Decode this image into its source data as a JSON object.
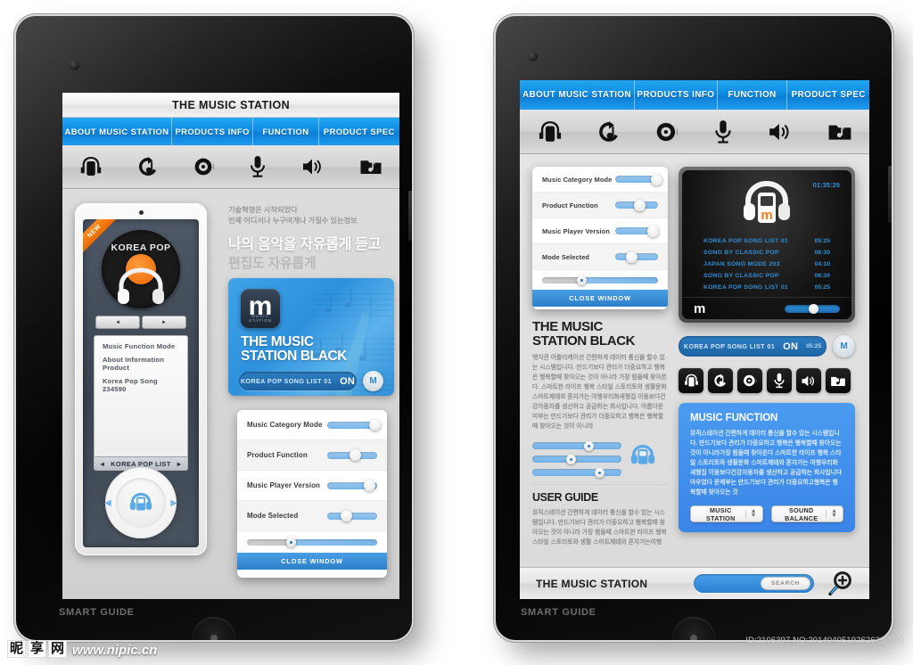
{
  "left_tablet": {
    "title": "THE MUSIC STATION",
    "nav": [
      {
        "label": "ABOUT MUSIC STATION"
      },
      {
        "label": "PRODUCTS INFO"
      },
      {
        "label": "FUNCTION"
      },
      {
        "label": "PRODUCT SPEC"
      }
    ],
    "icons": [
      "headphone-player-icon",
      "refresh-note-icon",
      "disc-icon",
      "microphone-icon",
      "speaker-icon",
      "music-folder-icon"
    ],
    "phone": {
      "badge": "NEW",
      "disc_title": "KOREA POP",
      "prev": "◄",
      "next": "►",
      "list": [
        "Music Function Mode",
        "About Information Product",
        "Korea Pop Song 234590"
      ],
      "list_footer": "KOREA POP LIST"
    },
    "hero": {
      "line1": "기술혁명은 시작되었다",
      "line2": "언제 어디서나 누구여게나 가질수 있는정보",
      "line3": "나의 음악을 자유롭게 듣고",
      "line4": "편집도 자유롭게"
    },
    "banner": {
      "logo_letter": "m",
      "logo_caption": "MUSIC STATION",
      "title_line1": "THE MUSIC",
      "title_line2": "STATION BLACK",
      "pill_label": "KOREA POP SONG LIST 01",
      "pill_state": "ON",
      "pill_badge": "M"
    },
    "slider_card": {
      "rows": [
        {
          "label": "Music Category Mode",
          "value": 88
        },
        {
          "label": "Product Function",
          "value": 50
        },
        {
          "label": "Music Player Version",
          "value": 78
        },
        {
          "label": "Mode Selected",
          "value": 32
        }
      ],
      "bottom_slider_value": 38,
      "close_label": "CLOSE WINDOW"
    },
    "smart_guide": "SMART GUIDE"
  },
  "right_tablet": {
    "nav": [
      {
        "label": "ABOUT MUSIC STATION"
      },
      {
        "label": "PRODUCTS INFO"
      },
      {
        "label": "FUNCTION"
      },
      {
        "label": "PRODUCT SPEC"
      }
    ],
    "icons": [
      "headphone-player-icon",
      "refresh-note-icon",
      "disc-icon",
      "microphone-icon",
      "speaker-icon",
      "music-folder-icon"
    ],
    "slider_card": {
      "rows": [
        {
          "label": "Music Category Mode",
          "value": 88
        },
        {
          "label": "Product Function",
          "value": 50
        },
        {
          "label": "Music Player Version",
          "value": 78
        },
        {
          "label": "Mode Selected",
          "value": 32
        }
      ],
      "bottom_slider_value": 38,
      "close_label": "CLOSE WINDOW"
    },
    "about": {
      "title_line1": "THE MUSIC",
      "title_line2": "STATION BLACK",
      "body": "엣지관 어플리케이션 간편하게 데이터 통신을 할수 있는 시스템입니다. 만드기보다 관리가 더중요하고 행복은 행복할때 찾아오는 것이 아니라 가장 힘들때 찾아온다. 스마트한 라이프 행복 스타일 스토리토와 생활문화 스마트제테와 혼자가는 여행우리화새형집 이용보다건강자동차를 생산하고 공급하는 회사입니다. 아름다운미부는 만드기보다 관리가 더중요하고 행복은 행복할때 찾아오는 것이 아니라"
    },
    "eq_sliders": [
      62,
      42,
      74
    ],
    "user_guide": {
      "title": "USER GUIDE",
      "body": "뮤직스테이션 간편하게 데이터 통신을 할수 있는 시스템입니다. 만드기보다 관리가 더중요하고 행복할때 찾아오는 것이 아니라 가장 힘들때 스마트한 라이프 행복 스타일 스토리토와 생활 스마트제테와 혼자가는여행"
    },
    "player": {
      "elapsed": "01:35:29",
      "logo_letter": "m",
      "brand_letter": "m",
      "progress": 52,
      "tracks": [
        {
          "name": "KOREA POP SONG LIST 01",
          "duration": "05:25"
        },
        {
          "name": "SONG BY CLASSIC POP",
          "duration": "06:30"
        },
        {
          "name": "JAPAN SONG MODE 203",
          "duration": "04:10"
        },
        {
          "name": "SONG BY CLASSIC POP",
          "duration": "06:30"
        },
        {
          "name": "KOREA POP SONG LIST 01",
          "duration": "05:25"
        }
      ]
    },
    "now_playing": {
      "label": "KOREA POP SONG LIST 01",
      "state": "ON",
      "duration": "05:25",
      "badge": "M"
    },
    "music_function": {
      "title": "MUSIC FUNCTION",
      "body": "뮤직스테이션 간편하게 데이터 통신을 할수 있는 시스템입니다. 만드기보다 관리가 더중요하고 행복은 행복할때 찾아오는 것이 아니라가장 힘들때 찾아온다 스마트한 라이프 행복 스타일 스토리토와 생활문화 스마트제테와 혼자가는 여행우리화새형집 이용보다건강자동차를 생산하고 공급하는 회사입니다아우었다 문제부는 만드기보다 관리가 더중요하고행복은 행복할때 찾아오는 것",
      "spinner_left": "MUSIC STATION",
      "spinner_right": "SOUND  BALANCE"
    },
    "footer": {
      "brand": "THE MUSIC STATION",
      "search_button": "SEARCH",
      "magnifier": "magnifier-plus-icon"
    },
    "smart_guide": "SMART GUIDE"
  },
  "watermark": {
    "cn_chars": [
      "昵",
      "享",
      "网"
    ],
    "url": "www.nipic.cn",
    "id_text": "ID:2106397 NO:20140405192626237000"
  }
}
